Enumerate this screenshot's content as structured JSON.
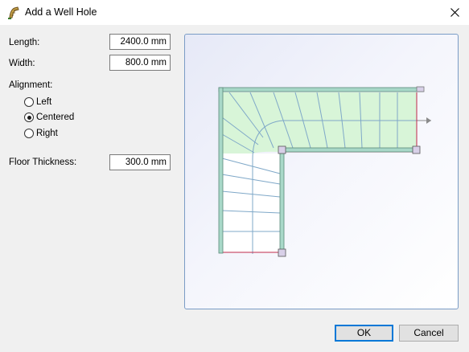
{
  "window": {
    "title": "Add a Well Hole"
  },
  "form": {
    "length_label": "Length:",
    "length_value": "2400.0 mm",
    "width_label": "Width:",
    "width_value": "800.0 mm",
    "alignment_label": "Alignment:",
    "alignment_options": [
      {
        "label": "Left",
        "checked": false
      },
      {
        "label": "Centered",
        "checked": true
      },
      {
        "label": "Right",
        "checked": false
      }
    ],
    "floor_thickness_label": "Floor Thickness:",
    "floor_thickness_value": "300.0 mm"
  },
  "buttons": {
    "ok": "OK",
    "cancel": "Cancel"
  },
  "colors": {
    "accent": "#0078d7",
    "wall": "#a8d8c8",
    "stair_fill": "#d8f5d8",
    "outline": "#c0284a"
  }
}
